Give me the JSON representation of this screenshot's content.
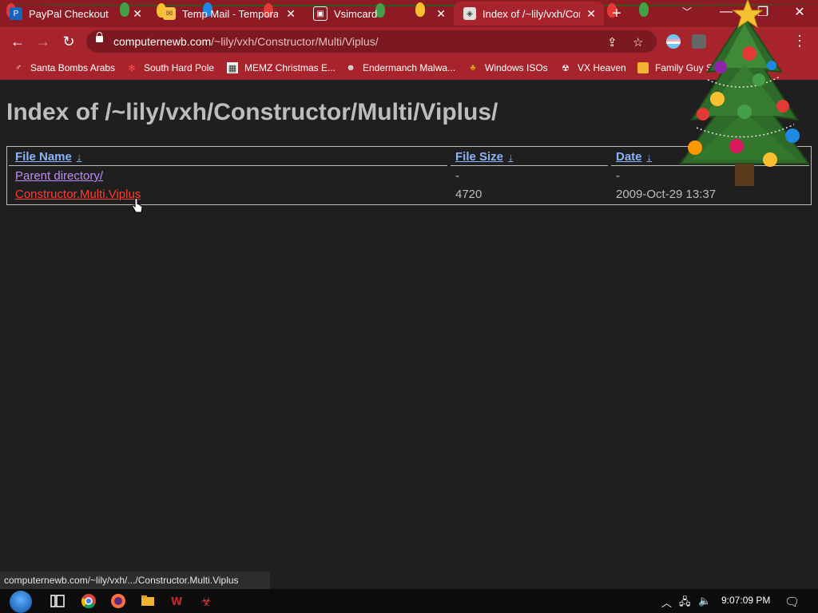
{
  "browser": {
    "tabs": [
      {
        "title": "PayPal Checkout",
        "icon": "paypal-icon",
        "active": false
      },
      {
        "title": "Temp Mail - Tempora",
        "icon": "mail-icon",
        "active": false
      },
      {
        "title": "Vsimcard",
        "icon": "simcard-icon",
        "active": false
      },
      {
        "title": "Index of /~lily/vxh/Con",
        "icon": "page-icon",
        "active": true
      }
    ],
    "new_tab_label": "+",
    "address": {
      "host": "computernewb.com",
      "path": "/~lily/vxh/Constructor/Multi/Viplus/"
    },
    "bookmarks": [
      {
        "label": "Santa Bombs Arabs",
        "icon": "santa-icon"
      },
      {
        "label": "South Hard Pole",
        "icon": "snowflake-icon"
      },
      {
        "label": "MEMZ Christmas E...",
        "icon": "memz-icon"
      },
      {
        "label": "Endermanch Malwa...",
        "icon": "raccoon-icon"
      },
      {
        "label": "Windows ISOs",
        "icon": "buddha-icon"
      },
      {
        "label": "VX Heaven",
        "icon": "vx-icon"
      },
      {
        "label": "Family Guy S",
        "icon": "folder-icon"
      }
    ]
  },
  "page": {
    "heading": "Index of /~lily/vxh/Constructor/Multi/Viplus/",
    "columns": [
      {
        "label": "File Name",
        "sort": "↓"
      },
      {
        "label": "File Size",
        "sort": "↓"
      },
      {
        "label": "Date",
        "sort": "↓"
      }
    ],
    "rows": [
      {
        "name": "Parent directory/",
        "size": "-",
        "date": "-"
      },
      {
        "name": "Constructor.Multi.Viplus",
        "size": "4720",
        "date": "2009-Oct-29 13:37"
      }
    ]
  },
  "status_bar": "computernewb.com/~lily/vxh/.../Constructor.Multi.Viplus",
  "taskbar": {
    "apps": [
      "task-view-icon",
      "chrome-icon",
      "firefox-icon",
      "file-explorer-icon",
      "app-icon",
      "biohazard-icon"
    ],
    "clock": "9:07:09 PM"
  },
  "colors": {
    "chrome_frame": "#a8242d",
    "tab_strip": "#8e1b23",
    "page_background": "#1f1f1f",
    "link": "#8ab4f8",
    "hover_link": "#ff3b30"
  }
}
